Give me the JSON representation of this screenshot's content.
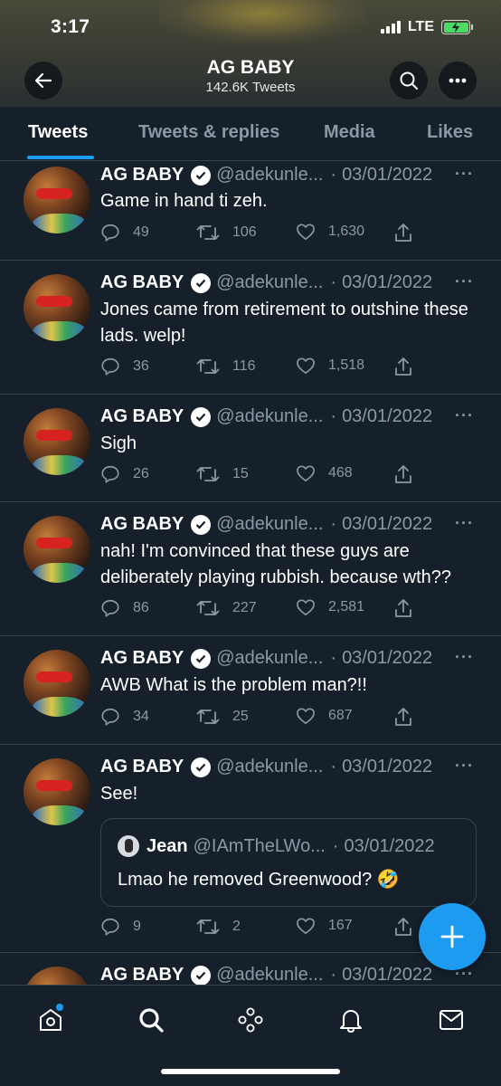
{
  "status_bar": {
    "time": "3:17",
    "network": "LTE"
  },
  "header": {
    "title": "AG BABY",
    "subtitle": "142.6K Tweets"
  },
  "tabs": [
    {
      "label": "Tweets",
      "active": true
    },
    {
      "label": "Tweets & replies",
      "active": false
    },
    {
      "label": "Media",
      "active": false
    },
    {
      "label": "Likes",
      "active": false
    }
  ],
  "tweets": [
    {
      "name": "AG BABY",
      "handle": "@adekunle...",
      "date": "03/01/2022",
      "text": "Game in hand ti zeh.",
      "replies": "49",
      "retweets": "106",
      "likes": "1,630"
    },
    {
      "name": "AG BABY",
      "handle": "@adekunle...",
      "date": "03/01/2022",
      "text": "Jones came from retirement to outshine these lads. welp!",
      "replies": "36",
      "retweets": "116",
      "likes": "1,518"
    },
    {
      "name": "AG BABY",
      "handle": "@adekunle...",
      "date": "03/01/2022",
      "text": "Sigh",
      "replies": "26",
      "retweets": "15",
      "likes": "468"
    },
    {
      "name": "AG BABY",
      "handle": "@adekunle...",
      "date": "03/01/2022",
      "text": "nah! I'm convinced that these guys are deliberately playing rubbish. because wth??",
      "replies": "86",
      "retweets": "227",
      "likes": "2,581"
    },
    {
      "name": "AG BABY",
      "handle": "@adekunle...",
      "date": "03/01/2022",
      "text": "AWB What is the problem man?!!",
      "replies": "34",
      "retweets": "25",
      "likes": "687"
    },
    {
      "name": "AG BABY",
      "handle": "@adekunle...",
      "date": "03/01/2022",
      "text": "See!",
      "replies": "9",
      "retweets": "2",
      "likes": "167",
      "quote": {
        "name": "Jean",
        "handle": "@IAmTheLWo...",
        "date": "03/01/2022",
        "text": "Lmao he removed Greenwood? 🤣"
      }
    },
    {
      "name": "AG BABY",
      "handle": "@adekunle...",
      "date": "03/01/2022"
    }
  ],
  "colors": {
    "accent": "#1d9bf0",
    "background": "#15202b",
    "muted": "#8b98a5",
    "divider": "#38444d"
  },
  "icons": {
    "header": [
      "back-arrow-icon",
      "search-icon",
      "more-icon"
    ],
    "actions": [
      "reply-icon",
      "retweet-icon",
      "like-icon",
      "share-icon"
    ],
    "nav": [
      "home-icon",
      "explore-icon",
      "spaces-icon",
      "notifications-icon",
      "messages-icon"
    ]
  }
}
